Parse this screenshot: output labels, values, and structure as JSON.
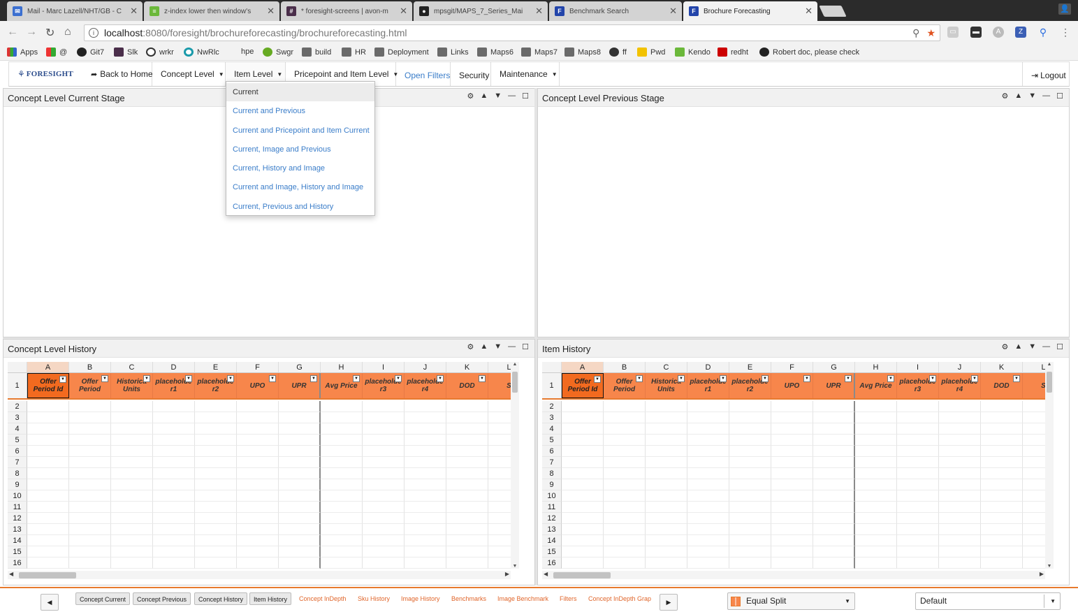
{
  "browser": {
    "tabs": [
      {
        "title": "Mail - Marc Lazell/NHT/GB - C",
        "icon": "mail-icon",
        "color": "#3b6fd0"
      },
      {
        "title": "z-index lower then window's",
        "icon": "stackoverflow-icon",
        "color": "#6bb83a"
      },
      {
        "title": "* foresight-screens | avon-m",
        "icon": "slack-icon",
        "color": "#4a2e4a"
      },
      {
        "title": "mpsgit/MAPS_7_Series_Mai",
        "icon": "github-icon",
        "color": "#222222"
      },
      {
        "title": "Benchmark Search",
        "icon": "foresight-icon",
        "color": "#2244aa"
      },
      {
        "title": "Brochure Forecasting",
        "icon": "foresight-icon",
        "color": "#2244aa"
      }
    ],
    "url_host": "localhost",
    "url_path": ":8080/foresight/brochureforecasting/brochureforecasting.html",
    "bookmarks": [
      "Apps",
      "@",
      "Git7",
      "Slk",
      "wrkr",
      "NwRlc",
      "hpe",
      "Swgr",
      "build",
      "HR",
      "Deployment",
      "Links",
      "Maps6",
      "Maps7",
      "Maps8",
      "ff",
      "Pwd",
      "Kendo",
      "redht",
      "Robert doc, please check"
    ]
  },
  "menu": {
    "logo": "FORESIGHT",
    "back_home": "Back to Home",
    "concept_level": "Concept Level",
    "item_level": "Item Level",
    "pricepoint_item_level": "Pricepoint and Item Level",
    "open_filters": "Open Filters",
    "security": "Security",
    "maintenance": "Maintenance",
    "logout": "Logout"
  },
  "item_level_dropdown": [
    "Current",
    "Current and Previous",
    "Current and Pricepoint and Item Current",
    "Current, Image and Previous",
    "Current, History and Image",
    "Current and Image, History and Image",
    "Current, Previous and History"
  ],
  "panels": {
    "concept_current": "Concept Level Current Stage",
    "concept_previous": "Concept Level Previous Stage",
    "concept_history": "Concept Level History",
    "item_history": "Item History"
  },
  "grid": {
    "col_letters": [
      "A",
      "B",
      "C",
      "D",
      "E",
      "F",
      "G",
      "H",
      "I",
      "J",
      "K",
      "L"
    ],
    "header_row_number": "1",
    "headers": [
      "Offer Period Id",
      "Offer Period",
      "Historical Units",
      "placeholder1",
      "placeholder2",
      "UPO",
      "UPR",
      "Avg Price",
      "placeholder3",
      "placeholder4",
      "DOD",
      "S"
    ],
    "header_display": [
      "Offer\nPeriod Id",
      "Offer\nPeriod",
      "Historica\nUnits",
      "placeholde\nr1",
      "placeholde\nr2",
      "UPO",
      "UPR",
      "Avg Price",
      "placeholde\nr3",
      "placeholde\nr4",
      "DOD",
      "S"
    ],
    "row_numbers": [
      "2",
      "3",
      "4",
      "5",
      "6",
      "7",
      "8",
      "9",
      "10",
      "11",
      "12",
      "13",
      "14",
      "15",
      "16"
    ]
  },
  "bottom": {
    "tabs": [
      {
        "label": "Concept Current",
        "active": true
      },
      {
        "label": "Concept Previous",
        "active": true
      },
      {
        "label": "Concept History",
        "active": true
      },
      {
        "label": "Item History",
        "active": true
      },
      {
        "label": "Concept InDepth",
        "active": false
      },
      {
        "label": "Sku History",
        "active": false
      },
      {
        "label": "Image History",
        "active": false
      },
      {
        "label": "Benchmarks",
        "active": false
      },
      {
        "label": "Image Benchmark",
        "active": false
      },
      {
        "label": "Filters",
        "active": false
      },
      {
        "label": "Concept InDepth Grap",
        "active": false
      }
    ],
    "layout_select": "Equal Split",
    "default_select": "Default"
  },
  "colors": {
    "accent_orange": "#e77a2e",
    "header_orange": "#f7864b",
    "link_blue": "#3a7dc9"
  }
}
